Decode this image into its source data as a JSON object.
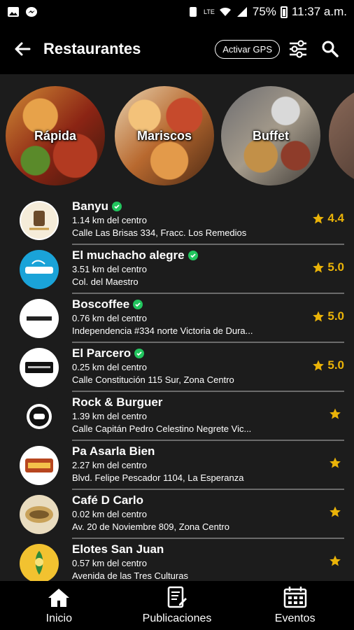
{
  "status": {
    "battery": "75%",
    "time": "11:37 a.m.",
    "network": "LTE"
  },
  "appbar": {
    "title": "Restaurantes",
    "gps_label": "Activar GPS"
  },
  "categories": [
    {
      "label": "Rápida"
    },
    {
      "label": "Mariscos"
    },
    {
      "label": "Buffet"
    },
    {
      "label": ""
    }
  ],
  "restaurants": [
    {
      "name": "Banyu",
      "distance": "1.14 km del centro",
      "address": "Calle Las Brisas 334, Fracc. Los Remedios",
      "rating": "4.4",
      "verified": true
    },
    {
      "name": "El muchacho alegre",
      "distance": "3.51 km del centro",
      "address": "Col. del Maestro",
      "rating": "5.0",
      "verified": true
    },
    {
      "name": "Boscoffee",
      "distance": "0.76 km del centro",
      "address": "Independencia #334 norte Victoria de Dura...",
      "rating": "5.0",
      "verified": true
    },
    {
      "name": "El Parcero",
      "distance": "0.25 km del centro",
      "address": "Calle Constitución 115 Sur, Zona Centro",
      "rating": "5.0",
      "verified": true
    },
    {
      "name": "Rock & Burguer",
      "distance": "1.39 km del centro",
      "address": "Calle Capitán Pedro Celestino Negrete Vic...",
      "rating": "",
      "verified": false
    },
    {
      "name": "Pa Asarla Bien",
      "distance": "2.27 km del centro",
      "address": "Blvd. Felipe Pescador 1104, La Esperanza",
      "rating": "",
      "verified": false
    },
    {
      "name": "Café D Carlo",
      "distance": "0.02 km del centro",
      "address": "Av. 20 de Noviembre 809, Zona Centro",
      "rating": "",
      "verified": false
    },
    {
      "name": "Elotes San Juan",
      "distance": "0.57 km del centro",
      "address": "Avenida de las Tres Culturas",
      "rating": "",
      "verified": false
    }
  ],
  "nav": {
    "home": "Inicio",
    "posts": "Publicaciones",
    "events": "Eventos"
  },
  "colors": {
    "accent_star": "#eab308",
    "verified": "#22c55e",
    "background": "#1c1c1c"
  }
}
